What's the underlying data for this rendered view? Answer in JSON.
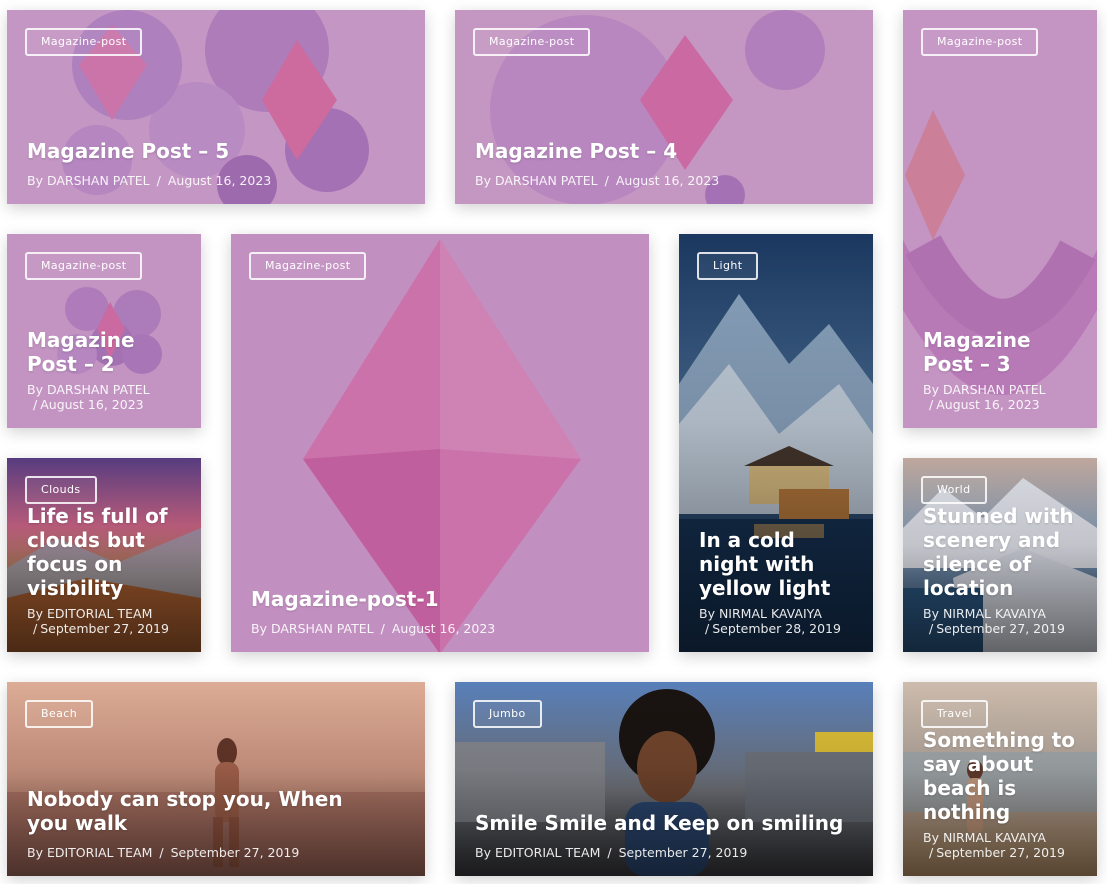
{
  "posts": [
    {
      "tag": "Magazine-post",
      "title": "Magazine Post – 5",
      "author": "By DARSHAN PATEL",
      "sep": "/",
      "date": "August 16, 2023"
    },
    {
      "tag": "Magazine-post",
      "title": "Magazine Post – 4",
      "author": "By DARSHAN PATEL",
      "sep": "/",
      "date": "August 16, 2023"
    },
    {
      "tag": "Magazine-post",
      "title": "Magazine Post – 3",
      "author": "By DARSHAN PATEL",
      "sep": "/",
      "date": "August 16, 2023"
    },
    {
      "tag": "Magazine-post",
      "title": "Magazine Post – 2",
      "author": "By DARSHAN PATEL",
      "sep": "/",
      "date": "August 16, 2023"
    },
    {
      "tag": "Magazine-post",
      "title": "Magazine-post-1",
      "author": "By DARSHAN PATEL",
      "sep": "/",
      "date": "August 16, 2023"
    },
    {
      "tag": "Light",
      "title": "In a cold night with yellow light",
      "author": "By NIRMAL KAVAIYA",
      "sep": "/",
      "date": "September 28, 2019"
    },
    {
      "tag": "Clouds",
      "title": "Life is full of clouds but focus on visibility",
      "author": "By EDITORIAL TEAM",
      "sep": "/",
      "date": "September 27, 2019"
    },
    {
      "tag": "World",
      "title": "Stunned with scenery and silence of location",
      "author": "By NIRMAL KAVAIYA",
      "sep": "/",
      "date": "September 27, 2019"
    },
    {
      "tag": "Beach",
      "title": "Nobody can stop you, When you walk",
      "author": "By EDITORIAL TEAM",
      "sep": "/",
      "date": "September 27, 2019"
    },
    {
      "tag": "Jumbo",
      "title": "Smile Smile and Keep on smiling",
      "author": "By EDITORIAL TEAM",
      "sep": "/",
      "date": "September 27, 2019"
    },
    {
      "tag": "Travel",
      "title": "Something to say about beach is nothing",
      "author": "By NIRMAL KAVAIYA",
      "sep": "/",
      "date": "September 27, 2019"
    }
  ],
  "colors": {
    "pink_overlay": "#a060a0",
    "pink_bg": "#c89ac4",
    "gem": "#e0609c",
    "text": "#ffffff"
  }
}
